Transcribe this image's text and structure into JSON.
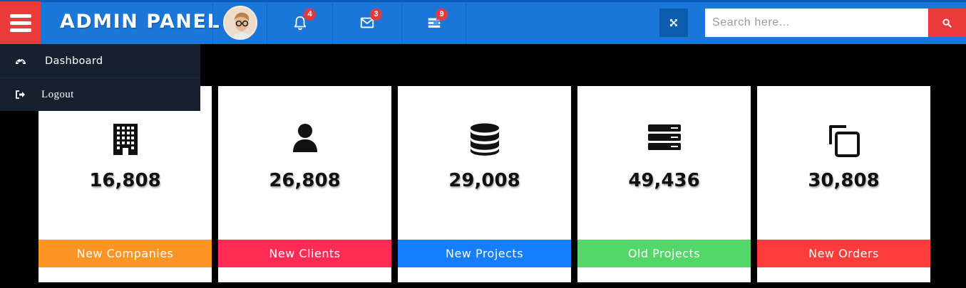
{
  "header": {
    "brand": "ADMIN PANEL",
    "search": {
      "placeholder": "Search here..."
    },
    "notifications": [
      {
        "icon": "bell-icon",
        "count": "4"
      },
      {
        "icon": "envelope-icon",
        "count": "3"
      },
      {
        "icon": "tasks-icon",
        "count": "9"
      }
    ],
    "colors": {
      "bar": "#1a76d7",
      "menu_button": "#ea3a3c",
      "badge": "#e23b3f"
    }
  },
  "sidebar": {
    "items": [
      {
        "label": "Dashboard",
        "icon": "dashboard-icon"
      },
      {
        "label": "Logout",
        "icon": "sign-out-icon"
      }
    ]
  },
  "cards": [
    {
      "value": "16,808",
      "label": "New Companies",
      "icon": "building-icon",
      "color": "#fd9426"
    },
    {
      "value": "26,808",
      "label": "New Clients",
      "icon": "user-icon",
      "color": "#ff2d55"
    },
    {
      "value": "29,008",
      "label": "New Projects",
      "icon": "database-icon",
      "color": "#147efb"
    },
    {
      "value": "49,436",
      "label": "Old Projects",
      "icon": "server-icon",
      "color": "#53d769"
    },
    {
      "value": "30,808",
      "label": "New Orders",
      "icon": "copy-icon",
      "color": "#fc3d39"
    }
  ]
}
